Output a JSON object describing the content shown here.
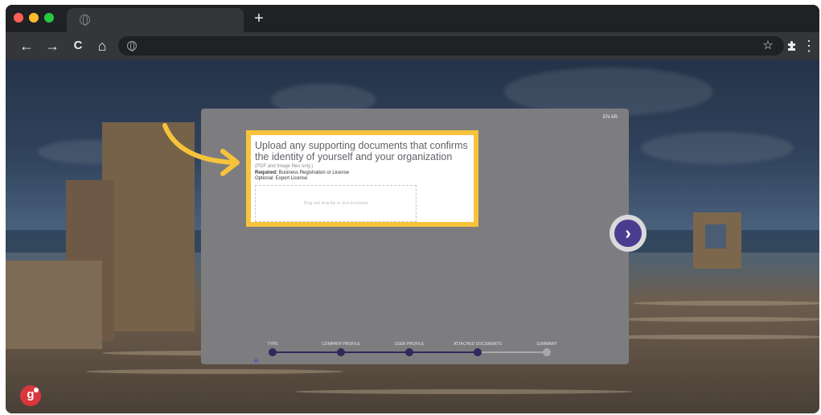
{
  "browser": {
    "traffic_lights": [
      "#ff5f57",
      "#febc2e",
      "#28c840"
    ],
    "tab_icon": "globe-icon",
    "new_tab_label": "+",
    "nav": {
      "back": "←",
      "forward": "→",
      "reload": "C",
      "home": "⌂"
    },
    "address_icon": "globe-icon",
    "address_value": "",
    "bookmark_icon": "☆",
    "extensions_icon": "puzzle-icon",
    "menu_icon": "⋮"
  },
  "modal": {
    "language_toggle": "EN AR",
    "upload": {
      "title": "Upload any supporting documents that confirms the identity of yourself and your organization",
      "note": "(PDF and Image files only.)",
      "required_label": "Required:",
      "required_value": "Business Registration or License",
      "optional_label": "Optional:",
      "optional_value": "Export License",
      "dropzone_text": "Drag and drop file or click to browse"
    },
    "steps": [
      {
        "label": "TYPE",
        "done": true
      },
      {
        "label": "COMPANY PROFILE",
        "done": true
      },
      {
        "label": "USER PROFILE",
        "done": true
      },
      {
        "label": "ATTACHED DOCUMENTS",
        "done": true
      },
      {
        "label": "SUMMARY",
        "done": false
      }
    ]
  },
  "next_button": "›",
  "logo": {
    "text": "g"
  },
  "colors": {
    "highlight": "#f6c33b",
    "accent": "#4a3d8f",
    "logo": "#d9363e"
  }
}
